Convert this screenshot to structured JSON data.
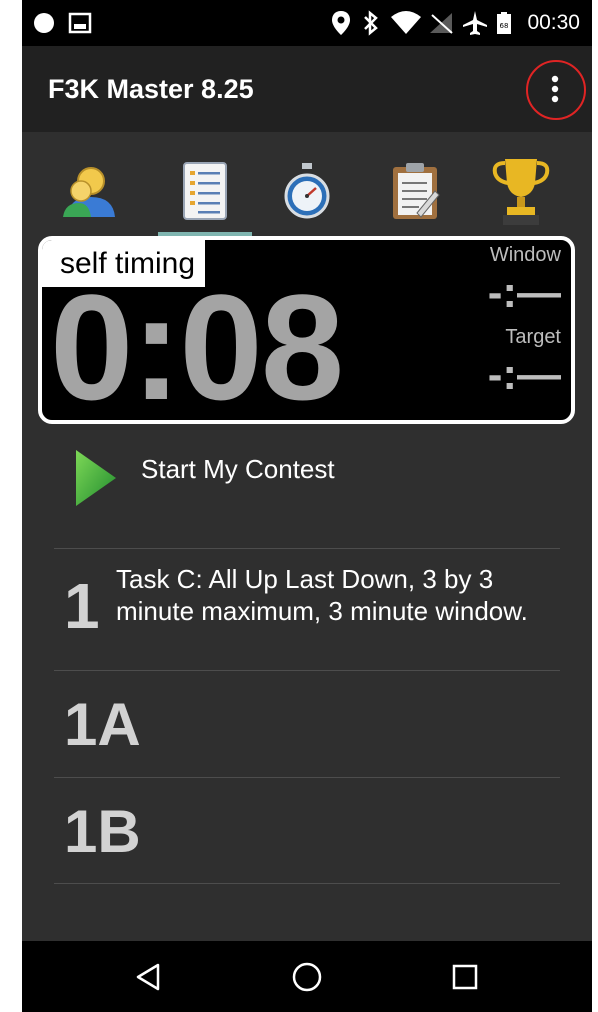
{
  "status_bar": {
    "time": "00:30",
    "battery_level": "68",
    "left_icons": [
      "notification-dot-icon",
      "image-icon"
    ],
    "right_icons": [
      "location-pin-icon",
      "bluetooth-icon",
      "wifi-icon",
      "no-sim-icon",
      "airplane-icon",
      "battery-icon"
    ]
  },
  "action_bar": {
    "title": "F3K Master 8.25",
    "overflow_icon": "more-vertical-icon"
  },
  "tabs": [
    {
      "name": "pilots",
      "icon": "pilots-icon"
    },
    {
      "name": "tasks",
      "icon": "task-list-icon",
      "selected": true
    },
    {
      "name": "timer",
      "icon": "stopwatch-icon"
    },
    {
      "name": "scores",
      "icon": "clipboard-icon"
    },
    {
      "name": "results",
      "icon": "trophy-icon"
    }
  ],
  "timer": {
    "mode": "self timing",
    "value": "0:08",
    "window_label": "Window",
    "window_value": "-:—",
    "target_label": "Target",
    "target_value": "-:—"
  },
  "start": {
    "label": "Start My Contest",
    "icon": "play-icon"
  },
  "task": {
    "number": "1",
    "description": "Task C: All Up Last Down, 3 by 3 minute maximum, 3 minute window."
  },
  "rounds": [
    "1A",
    "1B"
  ],
  "nav_bar": {
    "back_icon": "back-triangle-icon",
    "home_icon": "home-circle-icon",
    "recents_icon": "recents-square-icon"
  },
  "colors": {
    "background": "#2f2f2f",
    "action_bar": "#212121",
    "indicator": "#7fb5b0",
    "annotation": "#e02424",
    "timer_digits": "#a4a4a4"
  }
}
